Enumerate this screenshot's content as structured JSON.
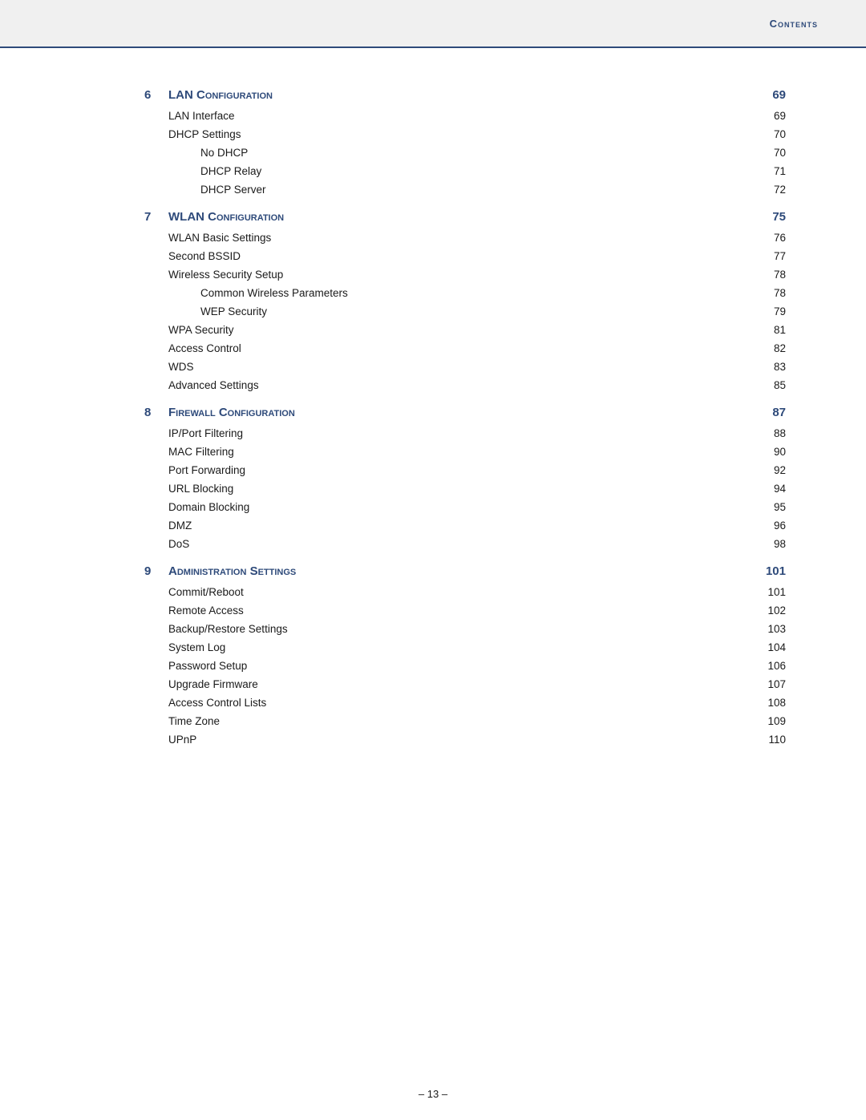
{
  "header": {
    "title": "Contents",
    "bar_color": "#2e4a7a",
    "bg_color": "#f0f0f0"
  },
  "footer": {
    "page_indicator": "– 13 –"
  },
  "sections": [
    {
      "id": "section6",
      "num": "6",
      "title": "LAN Configuration",
      "page": "69",
      "entries": [
        {
          "label": "LAN Interface",
          "page": "69",
          "indent": "normal"
        },
        {
          "label": "DHCP Settings",
          "page": "70",
          "indent": "normal"
        },
        {
          "label": "No DHCP",
          "page": "70",
          "indent": "sub"
        },
        {
          "label": "DHCP Relay",
          "page": "71",
          "indent": "sub"
        },
        {
          "label": "DHCP Server",
          "page": "72",
          "indent": "sub"
        }
      ]
    },
    {
      "id": "section7",
      "num": "7",
      "title": "WLAN Configuration",
      "page": "75",
      "entries": [
        {
          "label": "WLAN Basic Settings",
          "page": "76",
          "indent": "normal"
        },
        {
          "label": "Second BSSID",
          "page": "77",
          "indent": "normal"
        },
        {
          "label": "Wireless Security Setup",
          "page": "78",
          "indent": "normal"
        },
        {
          "label": "Common Wireless Parameters",
          "page": "78",
          "indent": "sub"
        },
        {
          "label": "WEP Security",
          "page": "79",
          "indent": "sub"
        },
        {
          "label": "WPA Security",
          "page": "81",
          "indent": "normal"
        },
        {
          "label": "Access Control",
          "page": "82",
          "indent": "normal"
        },
        {
          "label": "WDS",
          "page": "83",
          "indent": "normal"
        },
        {
          "label": "Advanced Settings",
          "page": "85",
          "indent": "normal"
        }
      ]
    },
    {
      "id": "section8",
      "num": "8",
      "title": "Firewall Configuration",
      "page": "87",
      "entries": [
        {
          "label": "IP/Port Filtering",
          "page": "88",
          "indent": "normal"
        },
        {
          "label": "MAC Filtering",
          "page": "90",
          "indent": "normal"
        },
        {
          "label": "Port Forwarding",
          "page": "92",
          "indent": "normal"
        },
        {
          "label": "URL Blocking",
          "page": "94",
          "indent": "normal"
        },
        {
          "label": "Domain Blocking",
          "page": "95",
          "indent": "normal"
        },
        {
          "label": "DMZ",
          "page": "96",
          "indent": "normal"
        },
        {
          "label": "DoS",
          "page": "98",
          "indent": "normal"
        }
      ]
    },
    {
      "id": "section9",
      "num": "9",
      "title": "Administration Settings",
      "page": "101",
      "entries": [
        {
          "label": "Commit/Reboot",
          "page": "101",
          "indent": "normal"
        },
        {
          "label": "Remote Access",
          "page": "102",
          "indent": "normal"
        },
        {
          "label": "Backup/Restore Settings",
          "page": "103",
          "indent": "normal"
        },
        {
          "label": "System Log",
          "page": "104",
          "indent": "normal"
        },
        {
          "label": "Password Setup",
          "page": "106",
          "indent": "normal"
        },
        {
          "label": "Upgrade Firmware",
          "page": "107",
          "indent": "normal"
        },
        {
          "label": "Access Control Lists",
          "page": "108",
          "indent": "normal"
        },
        {
          "label": "Time Zone",
          "page": "109",
          "indent": "normal"
        },
        {
          "label": "UPnP",
          "page": "110",
          "indent": "normal"
        }
      ]
    }
  ]
}
